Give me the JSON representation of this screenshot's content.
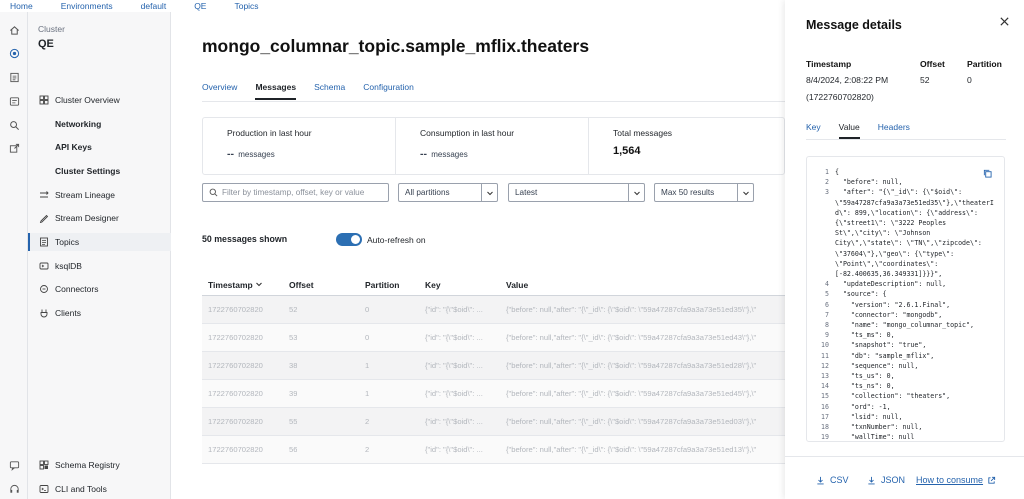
{
  "breadcrumb": [
    "Home",
    "Environments",
    "default",
    "QE",
    "Topics"
  ],
  "rail_icons": [
    "home-icon",
    "globe-icon",
    "list-icon",
    "data-icon",
    "search-icon",
    "share-icon",
    "chat-icon",
    "headset-icon"
  ],
  "sidebar": {
    "cluster_label": "Cluster",
    "cluster_name": "QE",
    "items": [
      {
        "label": "Cluster Overview",
        "icon": "grid-icon",
        "sub": false,
        "active": false
      },
      {
        "label": "Networking",
        "icon": "",
        "sub": true,
        "active": false
      },
      {
        "label": "API Keys",
        "icon": "",
        "sub": true,
        "active": false
      },
      {
        "label": "Cluster Settings",
        "icon": "",
        "sub": true,
        "active": false
      },
      {
        "label": "Stream Lineage",
        "icon": "lineage-icon",
        "sub": false,
        "active": false
      },
      {
        "label": "Stream Designer",
        "icon": "designer-icon",
        "sub": false,
        "active": false
      },
      {
        "label": "Topics",
        "icon": "topics-icon",
        "sub": false,
        "active": true
      },
      {
        "label": "ksqlDB",
        "icon": "ksql-icon",
        "sub": false,
        "active": false
      },
      {
        "label": "Connectors",
        "icon": "connectors-icon",
        "sub": false,
        "active": false
      },
      {
        "label": "Clients",
        "icon": "clients-icon",
        "sub": false,
        "active": false
      }
    ],
    "bottom_items": [
      {
        "label": "Schema Registry",
        "icon": "schema-icon"
      },
      {
        "label": "CLI and Tools",
        "icon": "terminal-icon"
      }
    ]
  },
  "main": {
    "title": "mongo_columnar_topic.sample_mflix.theaters",
    "tabs": [
      "Overview",
      "Messages",
      "Schema",
      "Configuration"
    ],
    "active_tab": "Messages",
    "stats": {
      "production_label": "Production in last hour",
      "production_value": "--",
      "production_unit": "messages",
      "consumption_label": "Consumption in last hour",
      "consumption_value": "--",
      "consumption_unit": "messages",
      "total_label": "Total messages",
      "total_value": "1,564"
    },
    "filters": {
      "search_placeholder": "Filter by timestamp, offset, key or value",
      "partitions": "All partitions",
      "position": "Latest",
      "max": "Max 50 results"
    },
    "shown_text": "50 messages shown",
    "auto_refresh_label": "Auto-refresh on",
    "table": {
      "columns": [
        "Timestamp",
        "Offset",
        "Partition",
        "Key",
        "Value"
      ],
      "rows": [
        {
          "timestamp": "1722760702820",
          "offset": "52",
          "partition": "0",
          "key": "{\"id\": \"{\\\"$oid\\\": ...",
          "value": "{\"before\": null,\"after\": \"{\\\"_id\\\": {\\\"$oid\\\": \\\"59a47287cfa9a3a73e51ed35\\\"},\\\""
        },
        {
          "timestamp": "1722760702820",
          "offset": "53",
          "partition": "0",
          "key": "{\"id\": \"{\\\"$oid\\\": ...",
          "value": "{\"before\": null,\"after\": \"{\\\"_id\\\": {\\\"$oid\\\": \\\"59a47287cfa9a3a73e51ed43\\\"},\\\""
        },
        {
          "timestamp": "1722760702820",
          "offset": "38",
          "partition": "1",
          "key": "{\"id\": \"{\\\"$oid\\\": ...",
          "value": "{\"before\": null,\"after\": \"{\\\"_id\\\": {\\\"$oid\\\": \\\"59a47287cfa9a3a73e51ed28\\\"},\\\""
        },
        {
          "timestamp": "1722760702820",
          "offset": "39",
          "partition": "1",
          "key": "{\"id\": \"{\\\"$oid\\\": ...",
          "value": "{\"before\": null,\"after\": \"{\\\"_id\\\": {\\\"$oid\\\": \\\"59a47287cfa9a3a73e51ed45\\\"},\\\""
        },
        {
          "timestamp": "1722760702820",
          "offset": "55",
          "partition": "2",
          "key": "{\"id\": \"{\\\"$oid\\\": ...",
          "value": "{\"before\": null,\"after\": \"{\\\"_id\\\": {\\\"$oid\\\": \\\"59a47287cfa9a3a73e51ed03\\\"},\\\""
        },
        {
          "timestamp": "1722760702820",
          "offset": "56",
          "partition": "2",
          "key": "{\"id\": \"{\\\"$oid\\\": ...",
          "value": "{\"before\": null,\"after\": \"{\\\"_id\\\": {\\\"$oid\\\": \\\"59a47287cfa9a3a73e51ed13\\\"},\\\""
        }
      ]
    }
  },
  "drawer": {
    "title": "Message details",
    "timestamp_label": "Timestamp",
    "timestamp_value": "8/4/2024, 2:08:22 PM",
    "timestamp_raw": "(1722760702820)",
    "offset_label": "Offset",
    "offset_value": "52",
    "partition_label": "Partition",
    "partition_value": "0",
    "tabs": [
      "Key",
      "Value",
      "Headers"
    ],
    "active_tab": "Value",
    "code_lines": [
      {
        "n": "1",
        "t": "{"
      },
      {
        "n": "2",
        "t": "  \"before\": null,"
      },
      {
        "n": "3",
        "t": "  \"after\": \"{\\\"_id\\\": {\\\"$oid\\\":"
      },
      {
        "n": "",
        "t": "\\\"59a47287cfa9a3a73e51ed35\\\"},\\\"theaterI"
      },
      {
        "n": "",
        "t": "d\\\": 899,\\\"location\\\": {\\\"address\\\":"
      },
      {
        "n": "",
        "t": "{\\\"street1\\\": \\\"3222 Peoples"
      },
      {
        "n": "",
        "t": "St\\\",\\\"city\\\": \\\"Johnson"
      },
      {
        "n": "",
        "t": "City\\\",\\\"state\\\": \\\"TN\\\",\\\"zipcode\\\":"
      },
      {
        "n": "",
        "t": "\\\"37604\\\"},\\\"geo\\\": {\\\"type\\\":"
      },
      {
        "n": "",
        "t": "\\\"Point\\\",\\\"coordinates\\\":"
      },
      {
        "n": "",
        "t": "[-82.400635,36.349331]}}}\","
      },
      {
        "n": "4",
        "t": "  \"updateDescription\": null,"
      },
      {
        "n": "5",
        "t": "  \"source\": {"
      },
      {
        "n": "6",
        "t": "    \"version\": \"2.6.1.Final\","
      },
      {
        "n": "7",
        "t": "    \"connector\": \"mongodb\","
      },
      {
        "n": "8",
        "t": "    \"name\": \"mongo_columnar_topic\","
      },
      {
        "n": "9",
        "t": "    \"ts_ms\": 0,"
      },
      {
        "n": "10",
        "t": "    \"snapshot\": \"true\","
      },
      {
        "n": "11",
        "t": "    \"db\": \"sample_mflix\","
      },
      {
        "n": "12",
        "t": "    \"sequence\": null,"
      },
      {
        "n": "13",
        "t": "    \"ts_us\": 0,"
      },
      {
        "n": "14",
        "t": "    \"ts_ns\": 0,"
      },
      {
        "n": "15",
        "t": "    \"collection\": \"theaters\","
      },
      {
        "n": "16",
        "t": "    \"ord\": -1,"
      },
      {
        "n": "17",
        "t": "    \"lsid\": null,"
      },
      {
        "n": "18",
        "t": "    \"txnNumber\": null,"
      },
      {
        "n": "19",
        "t": "    \"wallTime\": null"
      }
    ],
    "footer": {
      "csv": "CSV",
      "json": "JSON",
      "how": "How to consume"
    }
  },
  "colors": {
    "accent": "#2563ad",
    "toggle": "#2c6fb3"
  }
}
